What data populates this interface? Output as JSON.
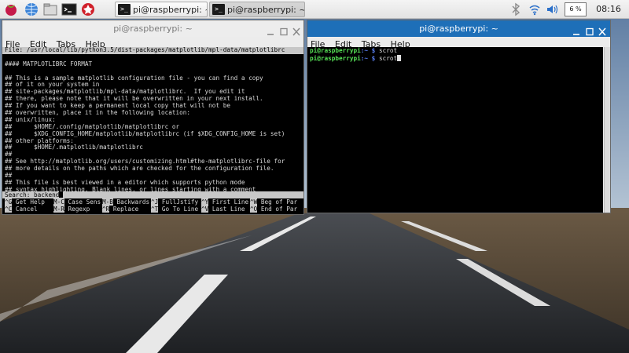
{
  "taskbar": {
    "launchers": [
      {
        "name": "raspberry-menu-icon"
      },
      {
        "name": "web-browser-icon"
      },
      {
        "name": "file-manager-icon"
      },
      {
        "name": "terminal-icon"
      },
      {
        "name": "wolfram-icon"
      }
    ],
    "tasks": [
      {
        "label": "pi@raspberrypi: ~",
        "active": false
      },
      {
        "label": "pi@raspberrypi: ~",
        "active": true
      }
    ],
    "cpu": "6 %",
    "clock": "08:16"
  },
  "left_window": {
    "title": "pi@raspberrypi: ~",
    "menu": [
      "File",
      "Edit",
      "Tabs",
      "Help"
    ],
    "nano_header": "File: /usr/local/lib/python3.5/dist-packages/matplotlib/mpl-data/matplotlibrc",
    "lines": [
      "",
      "#### MATPLOTLIBRC FORMAT",
      "",
      "## This is a sample matplotlib configuration file - you can find a copy",
      "## of it on your system in",
      "## site-packages/matplotlib/mpl-data/matplotlibrc.  If you edit it",
      "## there, please note that it will be overwritten in your next install.",
      "## If you want to keep a permanent local copy that will not be",
      "## overwritten, place it in the following location:",
      "## unix/linux:",
      "##      $HOME/.config/matplotlib/matplotlibrc or",
      "##      $XDG_CONFIG_HOME/matplotlib/matplotlibrc (if $XDG_CONFIG_HOME is set)",
      "## other platforms:",
      "##      $HOME/.matplotlib/matplotlibrc",
      "##",
      "## See http://matplotlib.org/users/customizing.html#the-matplotlibrc-file for",
      "## more details on the paths which are checked for the configuration file.",
      "##",
      "## This file is best viewed in a editor which supports python mode",
      "## syntax highlighting. Blank lines, or lines starting with a comment"
    ],
    "search_label": "Search: backend",
    "shortcuts_row1": [
      {
        "key": "^G",
        "label": "Get Help"
      },
      {
        "key": "M-C",
        "label": "Case Sens"
      },
      {
        "key": "M-B",
        "label": "Backwards"
      },
      {
        "key": "^J",
        "label": "FullJstify"
      },
      {
        "key": "^Y",
        "label": "First Line"
      },
      {
        "key": "^W",
        "label": "Beg of Par"
      }
    ],
    "shortcuts_row2": [
      {
        "key": "^C",
        "label": "Cancel"
      },
      {
        "key": "M-R",
        "label": "Regexp"
      },
      {
        "key": "^R",
        "label": "Replace"
      },
      {
        "key": "^T",
        "label": "Go To Line"
      },
      {
        "key": "^V",
        "label": "Last Line"
      },
      {
        "key": "^O",
        "label": "End of Par"
      }
    ]
  },
  "right_window": {
    "title": "pi@raspberrypi: ~",
    "menu": [
      "File",
      "Edit",
      "Tabs",
      "Help"
    ],
    "lines": [
      {
        "user": "pi@raspberrypi",
        "path": ":~ $",
        "cmd": " scrot"
      },
      {
        "user": "pi@raspberrypi",
        "path": ":~ $",
        "cmd": " scrot"
      }
    ]
  },
  "colors": {
    "active_title": "#1e6fb8",
    "inactive_title": "#ededed",
    "prompt_user": "#55e055",
    "prompt_path": "#5a7ff0"
  }
}
